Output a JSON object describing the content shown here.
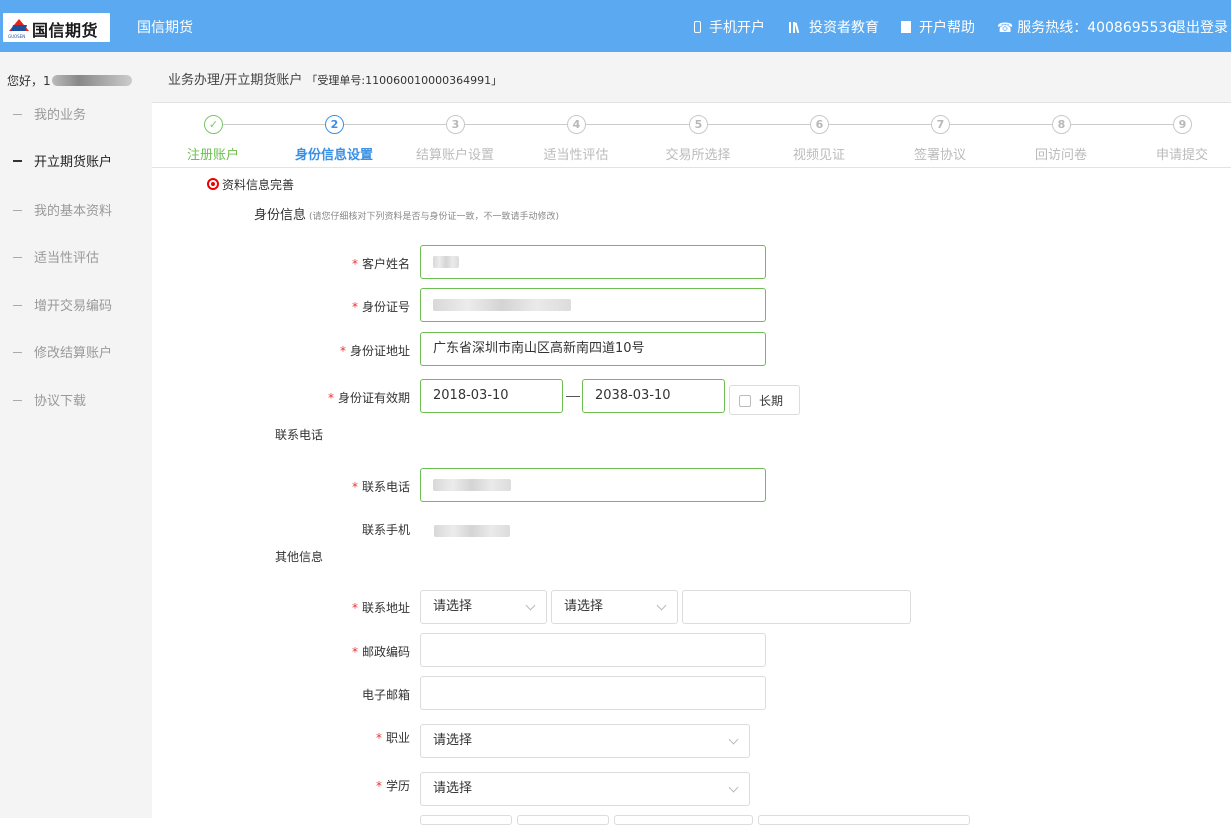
{
  "header": {
    "logo_text": "国信期货",
    "logo_sub": "GUOSEN",
    "brand": "国信期货",
    "nav": {
      "mobile": "手机开户",
      "education": "投资者教育",
      "help": "开户帮助",
      "hotline": "服务热线：4008695536",
      "logout": "退出登录"
    }
  },
  "sidebar": {
    "greeting": "您好，1",
    "items": [
      {
        "label": "我的业务"
      },
      {
        "label": "开立期货账户"
      },
      {
        "label": "我的基本资料"
      },
      {
        "label": "适当性评估"
      },
      {
        "label": "增开交易编码"
      },
      {
        "label": "修改结算账户"
      },
      {
        "label": "协议下载"
      }
    ]
  },
  "breadcrumb": {
    "path": "业务办理/开立期货账户",
    "order_no": "「受理单号:110060010000364991」"
  },
  "steps": [
    {
      "num": "✓",
      "label": "注册账户",
      "state": "done"
    },
    {
      "num": "2",
      "label": "身份信息设置",
      "state": "current"
    },
    {
      "num": "3",
      "label": "结算账户设置",
      "state": "todo"
    },
    {
      "num": "4",
      "label": "适当性评估",
      "state": "todo"
    },
    {
      "num": "5",
      "label": "交易所选择",
      "state": "todo"
    },
    {
      "num": "6",
      "label": "视频见证",
      "state": "todo"
    },
    {
      "num": "7",
      "label": "签署协议",
      "state": "todo"
    },
    {
      "num": "8",
      "label": "回访问卷",
      "state": "todo"
    },
    {
      "num": "9",
      "label": "申请提交",
      "state": "todo"
    }
  ],
  "form": {
    "section_title": "资料信息完善",
    "identity_title": "身份信息",
    "identity_hint": "(请您仔细核对下列资料是否与身份证一致，不一致请手动修改)",
    "name_label": "客户姓名",
    "id_label": "身份证号",
    "address_label": "身份证地址",
    "address_value": "广东省深圳市南山区高新南四道10号",
    "validity_label": "身份证有效期",
    "valid_from": "2018-03-10",
    "valid_to": "2038-03-10",
    "long_term_label": "长期",
    "phone_group_title": "联系电话",
    "phone_label": "联系电话",
    "mobile_label": "联系手机",
    "other_group_title": "其他信息",
    "contact_address_label": "联系地址",
    "select_placeholder": "请选择",
    "postcode_label": "邮政编码",
    "email_label": "电子邮箱",
    "occupation_label": "职业",
    "education_label": "学历"
  },
  "colors": {
    "header_bg": "#5aa9f1",
    "done": "#6cbe52",
    "current": "#3a8fe6",
    "required": "#e33"
  }
}
